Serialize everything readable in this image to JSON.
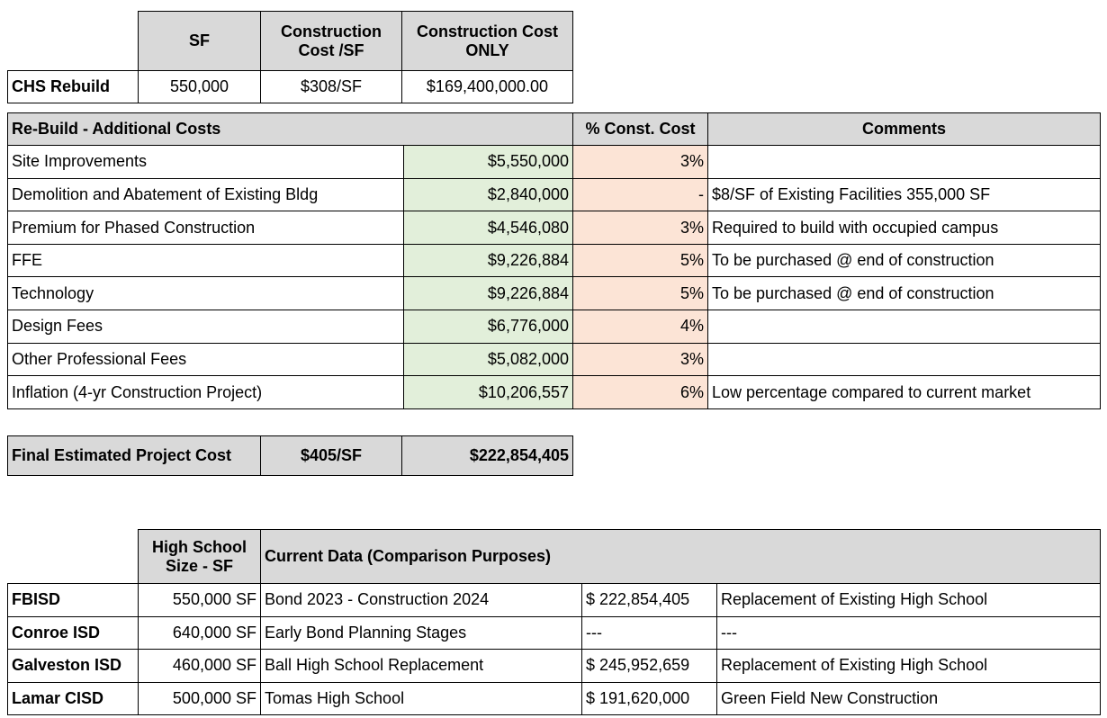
{
  "summary": {
    "headers": [
      "SF",
      "Construction Cost /SF",
      "Construction Cost ONLY"
    ],
    "row_label": "CHS Rebuild",
    "sf": "550,000",
    "cost_per_sf": "$308/SF",
    "cost_only": "$169,400,000.00"
  },
  "additional": {
    "header_label": "Re-Build - Additional Costs",
    "header_pct": "% Const. Cost",
    "header_comments": "Comments",
    "rows": [
      {
        "label": "Site Improvements",
        "amount": "$5,550,000",
        "pct": "3%",
        "comment": ""
      },
      {
        "label": "Demolition and Abatement of Existing Bldg",
        "amount": "$2,840,000",
        "pct": "-",
        "comment": "$8/SF of Existing Facilities 355,000 SF"
      },
      {
        "label": "Premium for Phased Construction",
        "amount": "$4,546,080",
        "pct": "3%",
        "comment": "Required to build with occupied campus"
      },
      {
        "label": "FFE",
        "amount": "$9,226,884",
        "pct": "5%",
        "comment": "To be purchased @ end of construction"
      },
      {
        "label": "Technology",
        "amount": "$9,226,884",
        "pct": "5%",
        "comment": "To be purchased @ end of construction"
      },
      {
        "label": "Design Fees",
        "amount": "$6,776,000",
        "pct": "4%",
        "comment": ""
      },
      {
        "label": "Other Professional Fees",
        "amount": "$5,082,000",
        "pct": "3%",
        "comment": ""
      },
      {
        "label": "Inflation (4-yr Construction Project)",
        "amount": "$10,206,557",
        "pct": "6%",
        "comment": "Low percentage compared to current market"
      }
    ]
  },
  "final": {
    "label": "Final Estimated Project Cost",
    "per_sf": "$405/SF",
    "total": "$222,854,405"
  },
  "comparison": {
    "header_size": "High School Size - SF",
    "header_data": "Current Data (Comparison Purposes)",
    "rows": [
      {
        "district": "FBISD",
        "size": "550,000 SF",
        "status": "Bond 2023 - Construction 2024",
        "cost": "$ 222,854,405",
        "note": "Replacement of Existing High School"
      },
      {
        "district": "Conroe ISD",
        "size": "640,000 SF",
        "status": "Early Bond Planning Stages",
        "cost": "---",
        "note": "---"
      },
      {
        "district": "Galveston ISD",
        "size": "460,000 SF",
        "status": "Ball High School Replacement",
        "cost": "$ 245,952,659",
        "note": "Replacement of Existing High School"
      },
      {
        "district": "Lamar CISD",
        "size": "500,000 SF",
        "status": "Tomas High School",
        "cost": "$ 191,620,000",
        "note": "Green Field New Construction"
      }
    ]
  }
}
